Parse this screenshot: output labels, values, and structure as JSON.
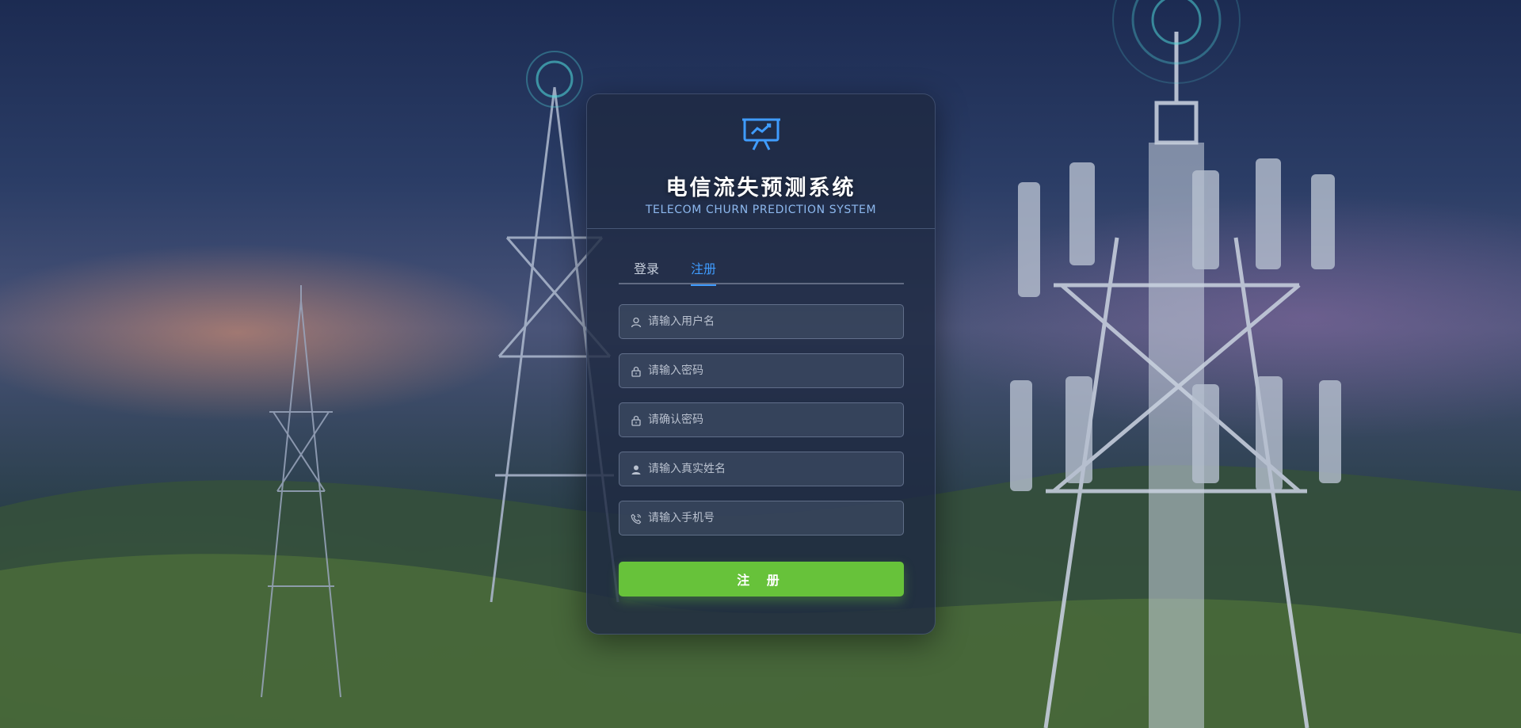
{
  "app": {
    "title": "电信流失预测系统",
    "subtitle": "TELECOM CHURN PREDICTION SYSTEM"
  },
  "tabs": [
    {
      "label": "登录",
      "active": false
    },
    {
      "label": "注册",
      "active": true
    }
  ],
  "form": {
    "username_placeholder": "请输入用户名",
    "password_placeholder": "请输入密码",
    "confirm_password_placeholder": "请确认密码",
    "realname_placeholder": "请输入真实姓名",
    "phone_placeholder": "请输入手机号",
    "submit_label": "注 册"
  },
  "colors": {
    "accent": "#3f9cff",
    "submit": "#67c23a"
  },
  "icons": [
    "chart-presentation-icon",
    "user-icon",
    "lock-icon",
    "person-icon",
    "phone-icon"
  ]
}
